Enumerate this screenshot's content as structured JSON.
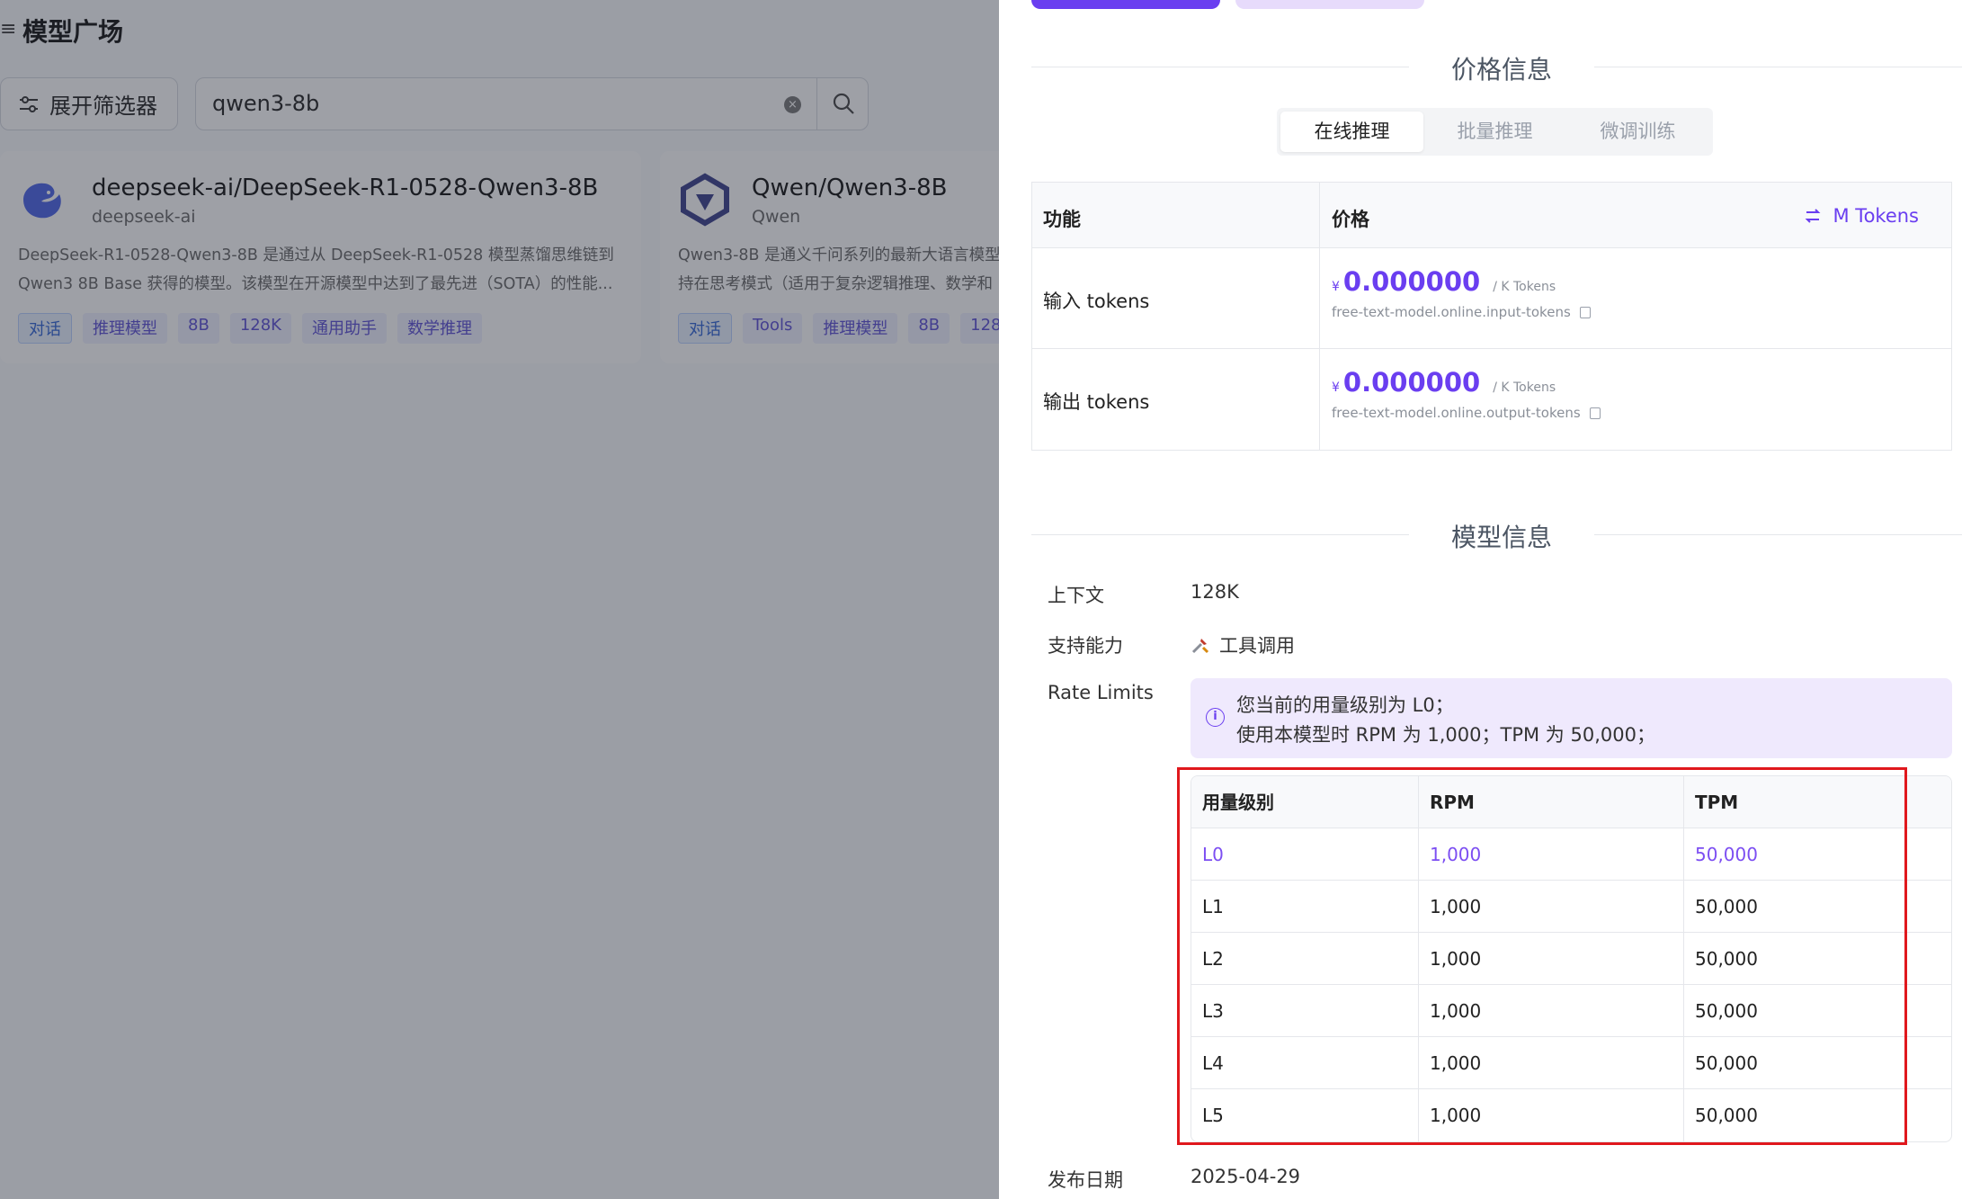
{
  "left": {
    "menu_icon": "≡",
    "title": "模型广场",
    "filter_button": "展开筛选器",
    "search_value": "qwen3-8b",
    "cards": [
      {
        "title": "deepseek-ai/DeepSeek-R1-0528-Qwen3-8B",
        "sub": "deepseek-ai",
        "desc1": "DeepSeek-R1-0528-Qwen3-8B 是通过从 DeepSeek-R1-0528 模型蒸馏思维链到",
        "desc2": "Qwen3 8B Base 获得的模型。该模型在开源模型中达到了最先进（SOTA）的性能...",
        "tags": [
          "对话",
          "推理模型",
          "8B",
          "128K",
          "通用助手",
          "数学推理"
        ]
      },
      {
        "title": "Qwen/Qwen3-8B",
        "sub": "Qwen",
        "desc1": "Qwen3-8B 是通义千问系列的最新大语言模型",
        "desc2": "持在思考模式（适用于复杂逻辑推理、数学和",
        "tags": [
          "对话",
          "Tools",
          "推理模型",
          "8B",
          "128"
        ]
      }
    ]
  },
  "drawer": {
    "price_section": "价格信息",
    "tabs": [
      "在线推理",
      "批量推理",
      "微调训练"
    ],
    "price_table": {
      "col1": "功能",
      "col2": "价格",
      "unit_toggle": "M Tokens",
      "rows": [
        {
          "label": "输入 tokens",
          "yen": "¥",
          "price": "0.000000",
          "unit": "/ K Tokens",
          "code": "free-text-model.online.input-tokens"
        },
        {
          "label": "输出 tokens",
          "yen": "¥",
          "price": "0.000000",
          "unit": "/ K Tokens",
          "code": "free-text-model.online.output-tokens"
        }
      ]
    },
    "model_section": "模型信息",
    "context_label": "上下文",
    "context_value": "128K",
    "capability_label": "支持能力",
    "capability_value": "工具调用",
    "rate_label": "Rate Limits",
    "alert_line1": "您当前的用量级别为 L0；",
    "alert_line2": "使用本模型时 RPM 为 1,000；TPM 为 50,000；",
    "rate_table": {
      "headers": [
        "用量级别",
        "RPM",
        "TPM"
      ],
      "rows": [
        [
          "L0",
          "1,000",
          "50,000"
        ],
        [
          "L1",
          "1,000",
          "50,000"
        ],
        [
          "L2",
          "1,000",
          "50,000"
        ],
        [
          "L3",
          "1,000",
          "50,000"
        ],
        [
          "L4",
          "1,000",
          "50,000"
        ],
        [
          "L5",
          "1,000",
          "50,000"
        ]
      ]
    },
    "release_label": "发布日期",
    "release_value": "2025-04-29"
  },
  "colors": {
    "accent": "#6a3ef0",
    "highlight_border": "#e0181d"
  }
}
